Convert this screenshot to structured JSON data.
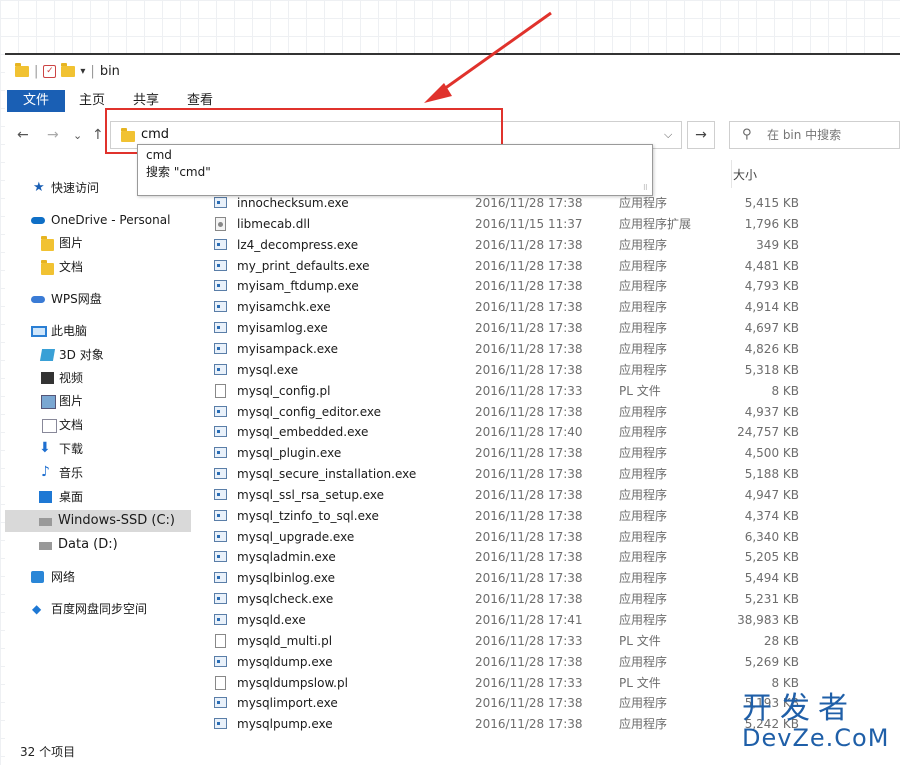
{
  "window": {
    "title": "bin"
  },
  "ribbon": {
    "tabs": [
      "文件",
      "主页",
      "共享",
      "查看"
    ]
  },
  "nav": {
    "back": "←",
    "forward": "→",
    "recent": "⌄",
    "up": "↑",
    "address_value": "cmd",
    "go": "→",
    "search_placeholder": "在 bin 中搜索"
  },
  "autocomplete": {
    "items": [
      "cmd",
      "搜索 \"cmd\""
    ]
  },
  "sidebar": {
    "items": [
      {
        "label": "快速访问",
        "icon": "star-icon"
      },
      {
        "label": "OneDrive - Personal",
        "icon": "onedrive-icon"
      },
      {
        "label": "图片",
        "icon": "folder-icon"
      },
      {
        "label": "文档",
        "icon": "folder-icon"
      },
      {
        "label": "WPS网盘",
        "icon": "wps-cloud-icon"
      },
      {
        "label": "此电脑",
        "icon": "this-pc-icon"
      },
      {
        "label": "3D 对象",
        "icon": "3d-objects-icon"
      },
      {
        "label": "视频",
        "icon": "videos-icon"
      },
      {
        "label": "图片",
        "icon": "pictures-icon"
      },
      {
        "label": "文档",
        "icon": "documents-icon"
      },
      {
        "label": "下载",
        "icon": "downloads-icon"
      },
      {
        "label": "音乐",
        "icon": "music-icon"
      },
      {
        "label": "桌面",
        "icon": "desktop-icon"
      },
      {
        "label": "Windows-SSD (C:)",
        "icon": "drive-c-icon"
      },
      {
        "label": "Data (D:)",
        "icon": "drive-d-icon"
      },
      {
        "label": "网络",
        "icon": "network-icon"
      },
      {
        "label": "百度网盘同步空间",
        "icon": "baidu-sync-icon"
      }
    ]
  },
  "columns": {
    "size": "大小"
  },
  "files": [
    {
      "name": "innochecksum.exe",
      "date": "2016/11/28 17:38",
      "type": "应用程序",
      "size": "5,415 KB",
      "icon": "exe"
    },
    {
      "name": "libmecab.dll",
      "date": "2016/11/15 11:37",
      "type": "应用程序扩展",
      "size": "1,796 KB",
      "icon": "dll"
    },
    {
      "name": "lz4_decompress.exe",
      "date": "2016/11/28 17:38",
      "type": "应用程序",
      "size": "349 KB",
      "icon": "exe"
    },
    {
      "name": "my_print_defaults.exe",
      "date": "2016/11/28 17:38",
      "type": "应用程序",
      "size": "4,481 KB",
      "icon": "exe"
    },
    {
      "name": "myisam_ftdump.exe",
      "date": "2016/11/28 17:38",
      "type": "应用程序",
      "size": "4,793 KB",
      "icon": "exe"
    },
    {
      "name": "myisamchk.exe",
      "date": "2016/11/28 17:38",
      "type": "应用程序",
      "size": "4,914 KB",
      "icon": "exe"
    },
    {
      "name": "myisamlog.exe",
      "date": "2016/11/28 17:38",
      "type": "应用程序",
      "size": "4,697 KB",
      "icon": "exe"
    },
    {
      "name": "myisampack.exe",
      "date": "2016/11/28 17:38",
      "type": "应用程序",
      "size": "4,826 KB",
      "icon": "exe"
    },
    {
      "name": "mysql.exe",
      "date": "2016/11/28 17:38",
      "type": "应用程序",
      "size": "5,318 KB",
      "icon": "exe"
    },
    {
      "name": "mysql_config.pl",
      "date": "2016/11/28 17:33",
      "type": "PL 文件",
      "size": "8 KB",
      "icon": "doc"
    },
    {
      "name": "mysql_config_editor.exe",
      "date": "2016/11/28 17:38",
      "type": "应用程序",
      "size": "4,937 KB",
      "icon": "exe"
    },
    {
      "name": "mysql_embedded.exe",
      "date": "2016/11/28 17:40",
      "type": "应用程序",
      "size": "24,757 KB",
      "icon": "exe"
    },
    {
      "name": "mysql_plugin.exe",
      "date": "2016/11/28 17:38",
      "type": "应用程序",
      "size": "4,500 KB",
      "icon": "exe"
    },
    {
      "name": "mysql_secure_installation.exe",
      "date": "2016/11/28 17:38",
      "type": "应用程序",
      "size": "5,188 KB",
      "icon": "exe"
    },
    {
      "name": "mysql_ssl_rsa_setup.exe",
      "date": "2016/11/28 17:38",
      "type": "应用程序",
      "size": "4,947 KB",
      "icon": "exe"
    },
    {
      "name": "mysql_tzinfo_to_sql.exe",
      "date": "2016/11/28 17:38",
      "type": "应用程序",
      "size": "4,374 KB",
      "icon": "exe"
    },
    {
      "name": "mysql_upgrade.exe",
      "date": "2016/11/28 17:38",
      "type": "应用程序",
      "size": "6,340 KB",
      "icon": "exe"
    },
    {
      "name": "mysqladmin.exe",
      "date": "2016/11/28 17:38",
      "type": "应用程序",
      "size": "5,205 KB",
      "icon": "exe"
    },
    {
      "name": "mysqlbinlog.exe",
      "date": "2016/11/28 17:38",
      "type": "应用程序",
      "size": "5,494 KB",
      "icon": "exe"
    },
    {
      "name": "mysqlcheck.exe",
      "date": "2016/11/28 17:38",
      "type": "应用程序",
      "size": "5,231 KB",
      "icon": "exe"
    },
    {
      "name": "mysqld.exe",
      "date": "2016/11/28 17:41",
      "type": "应用程序",
      "size": "38,983 KB",
      "icon": "exe"
    },
    {
      "name": "mysqld_multi.pl",
      "date": "2016/11/28 17:33",
      "type": "PL 文件",
      "size": "28 KB",
      "icon": "doc"
    },
    {
      "name": "mysqldump.exe",
      "date": "2016/11/28 17:38",
      "type": "应用程序",
      "size": "5,269 KB",
      "icon": "exe"
    },
    {
      "name": "mysqldumpslow.pl",
      "date": "2016/11/28 17:33",
      "type": "PL 文件",
      "size": "8 KB",
      "icon": "doc"
    },
    {
      "name": "mysqlimport.exe",
      "date": "2016/11/28 17:38",
      "type": "应用程序",
      "size": "5,193 KB",
      "icon": "exe"
    },
    {
      "name": "mysqlpump.exe",
      "date": "2016/11/28 17:38",
      "type": "应用程序",
      "size": "5,242 KB",
      "icon": "exe"
    }
  ],
  "status": {
    "item_count": "32 个项目"
  },
  "watermark": {
    "line1": "开发者",
    "line2": "DevZe.CoM"
  },
  "colors": {
    "accent": "#1a5fb4",
    "highlight": "#e0322c"
  }
}
